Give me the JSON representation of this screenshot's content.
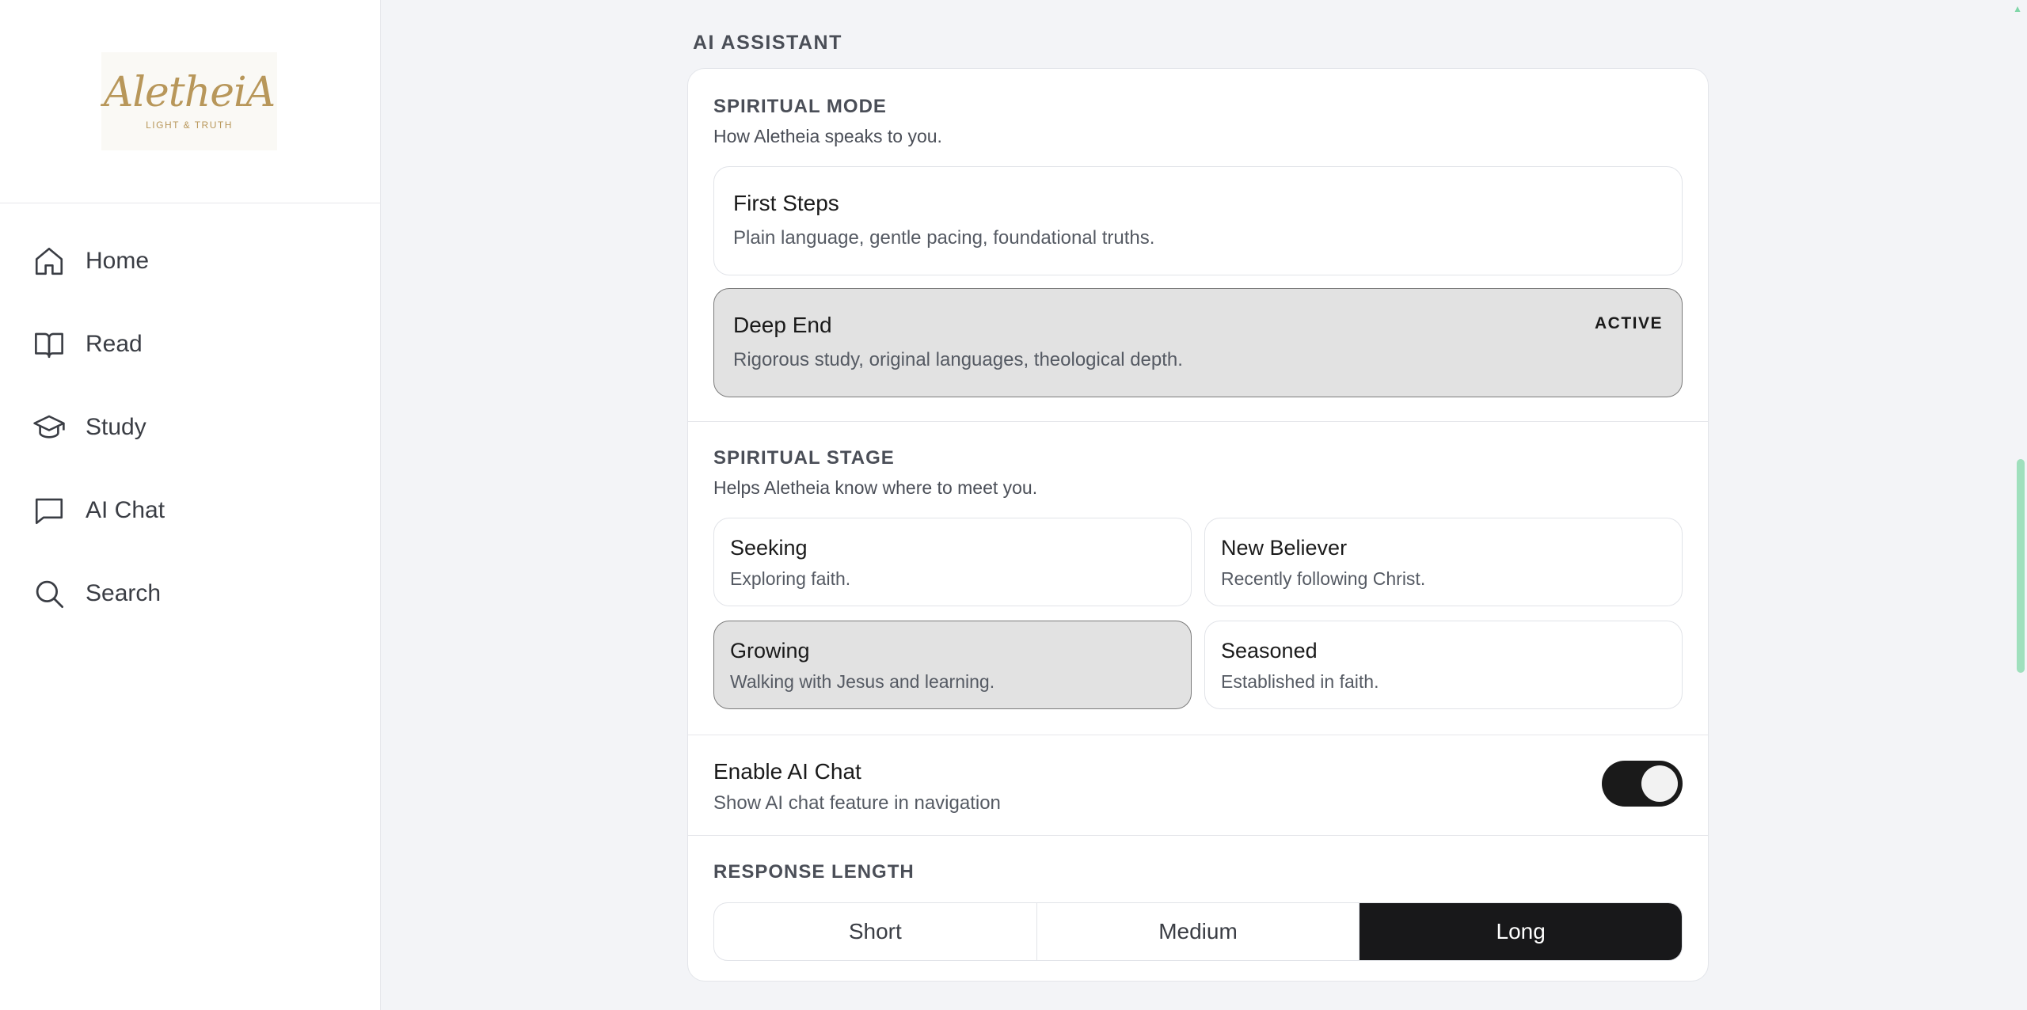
{
  "brand": {
    "logo_text": "AletheiA",
    "logo_tagline": "LIGHT & TRUTH"
  },
  "nav": {
    "items": [
      {
        "label": "Home",
        "icon": "home-icon"
      },
      {
        "label": "Read",
        "icon": "book-icon"
      },
      {
        "label": "Study",
        "icon": "graduation-cap-icon"
      },
      {
        "label": "AI Chat",
        "icon": "chat-bubble-icon"
      },
      {
        "label": "Search",
        "icon": "search-icon"
      }
    ]
  },
  "section": {
    "title": "AI ASSISTANT"
  },
  "spiritual_mode": {
    "title": "SPIRITUAL MODE",
    "description": "How Aletheia speaks to you.",
    "options": [
      {
        "name": "First Steps",
        "description": "Plain language, gentle pacing, foundational truths.",
        "active": false
      },
      {
        "name": "Deep End",
        "description": "Rigorous study, original languages, theological depth.",
        "active": true
      }
    ],
    "active_badge": "ACTIVE"
  },
  "spiritual_stage": {
    "title": "SPIRITUAL STAGE",
    "description": "Helps Aletheia know where to meet you.",
    "options": [
      {
        "name": "Seeking",
        "description": "Exploring faith.",
        "active": false
      },
      {
        "name": "New Believer",
        "description": "Recently following Christ.",
        "active": false
      },
      {
        "name": "Growing",
        "description": "Walking with Jesus and learning.",
        "active": true
      },
      {
        "name": "Seasoned",
        "description": "Established in faith.",
        "active": false
      }
    ]
  },
  "ai_chat_toggle": {
    "title": "Enable AI Chat",
    "description": "Show AI chat feature in navigation",
    "enabled": true
  },
  "response_length": {
    "title": "RESPONSE LENGTH",
    "options": [
      "Short",
      "Medium",
      "Long"
    ],
    "selected": "Long"
  },
  "colors": {
    "accent_dark": "#18181a",
    "logo_gold": "#b8975a",
    "scrollbar": "#9fe0bd"
  }
}
